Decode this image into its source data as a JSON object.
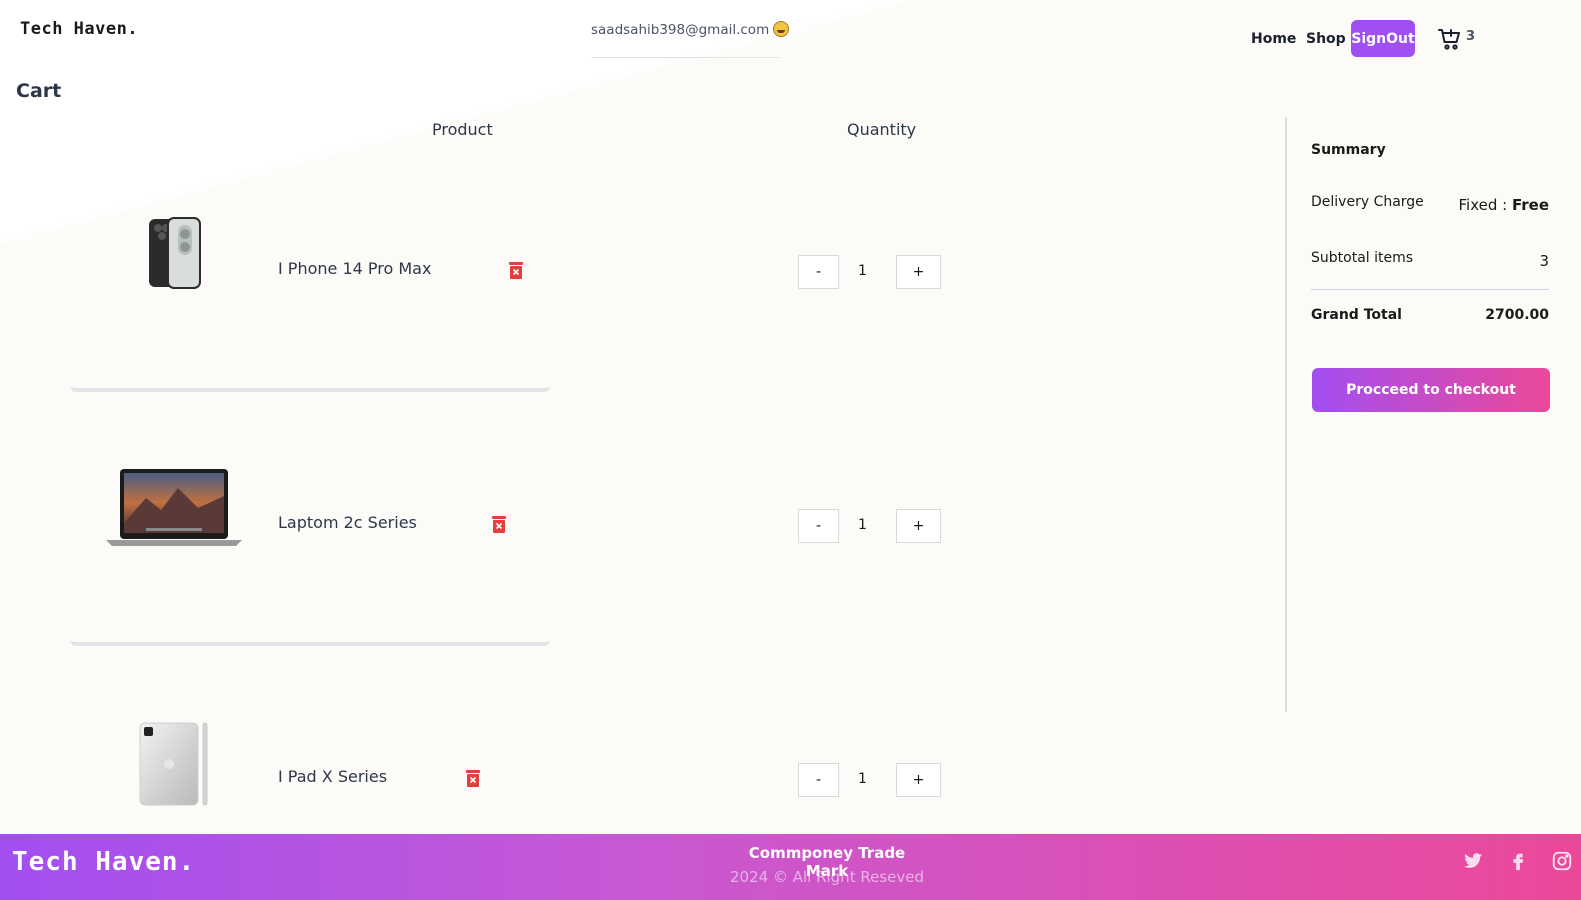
{
  "header": {
    "logo": "Tech Haven.",
    "user_email": "saadsahib398@gmail.com",
    "nav": {
      "home": "Home",
      "shop": "Shop",
      "signout": "SignOut"
    },
    "cart_count": "3"
  },
  "cart": {
    "title": "Cart",
    "columns": {
      "product": "Product",
      "quantity": "Quantity"
    },
    "items": [
      {
        "name": "I Phone 14 Pro Max",
        "quantity": "1",
        "minus": "-",
        "plus": "+",
        "image": "iphone-image"
      },
      {
        "name": "Laptom 2c Series",
        "quantity": "1",
        "minus": "-",
        "plus": "+",
        "image": "laptop-image"
      },
      {
        "name": "I Pad X Series",
        "quantity": "1",
        "minus": "-",
        "plus": "+",
        "image": "ipad-image"
      }
    ]
  },
  "summary": {
    "title": "Summary",
    "delivery_label": "Delivery Charge",
    "delivery_prefix": "Fixed : ",
    "delivery_value": "Free",
    "subtotal_label": "Subtotal items",
    "subtotal_value": "3",
    "grand_total_label": "Grand Total",
    "grand_total_value": "2700.00",
    "checkout_label": "Procceed to checkout"
  },
  "footer": {
    "logo": "Tech Haven.",
    "trademark": "Commponey Trade Mark",
    "copyright": "2024 © All Right Reseved",
    "social": [
      "twitter-icon",
      "facebook-icon",
      "instagram-icon"
    ]
  },
  "colors": {
    "accent_purple": "#a24ff1",
    "accent_pink": "#ec4899",
    "trash_red": "#e53e3e"
  }
}
